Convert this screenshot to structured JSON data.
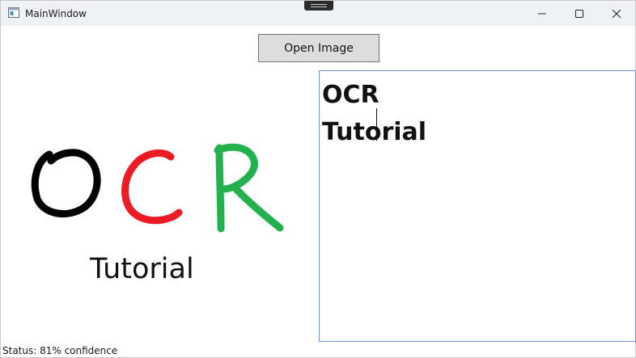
{
  "window": {
    "title": "MainWindow",
    "minimize_icon": "minimize-icon",
    "maximize_icon": "maximize-icon",
    "close_icon": "close-icon"
  },
  "toolbar": {
    "open_button_label": "Open Image"
  },
  "image": {
    "letters": [
      "O",
      "C",
      "R"
    ],
    "letter_colors": [
      "#000000",
      "#ed1c24",
      "#22b14c"
    ],
    "caption": "Tutorial"
  },
  "result": {
    "text": "OCR\nTutorial"
  },
  "status": {
    "text": "Status: 81% confidence"
  }
}
